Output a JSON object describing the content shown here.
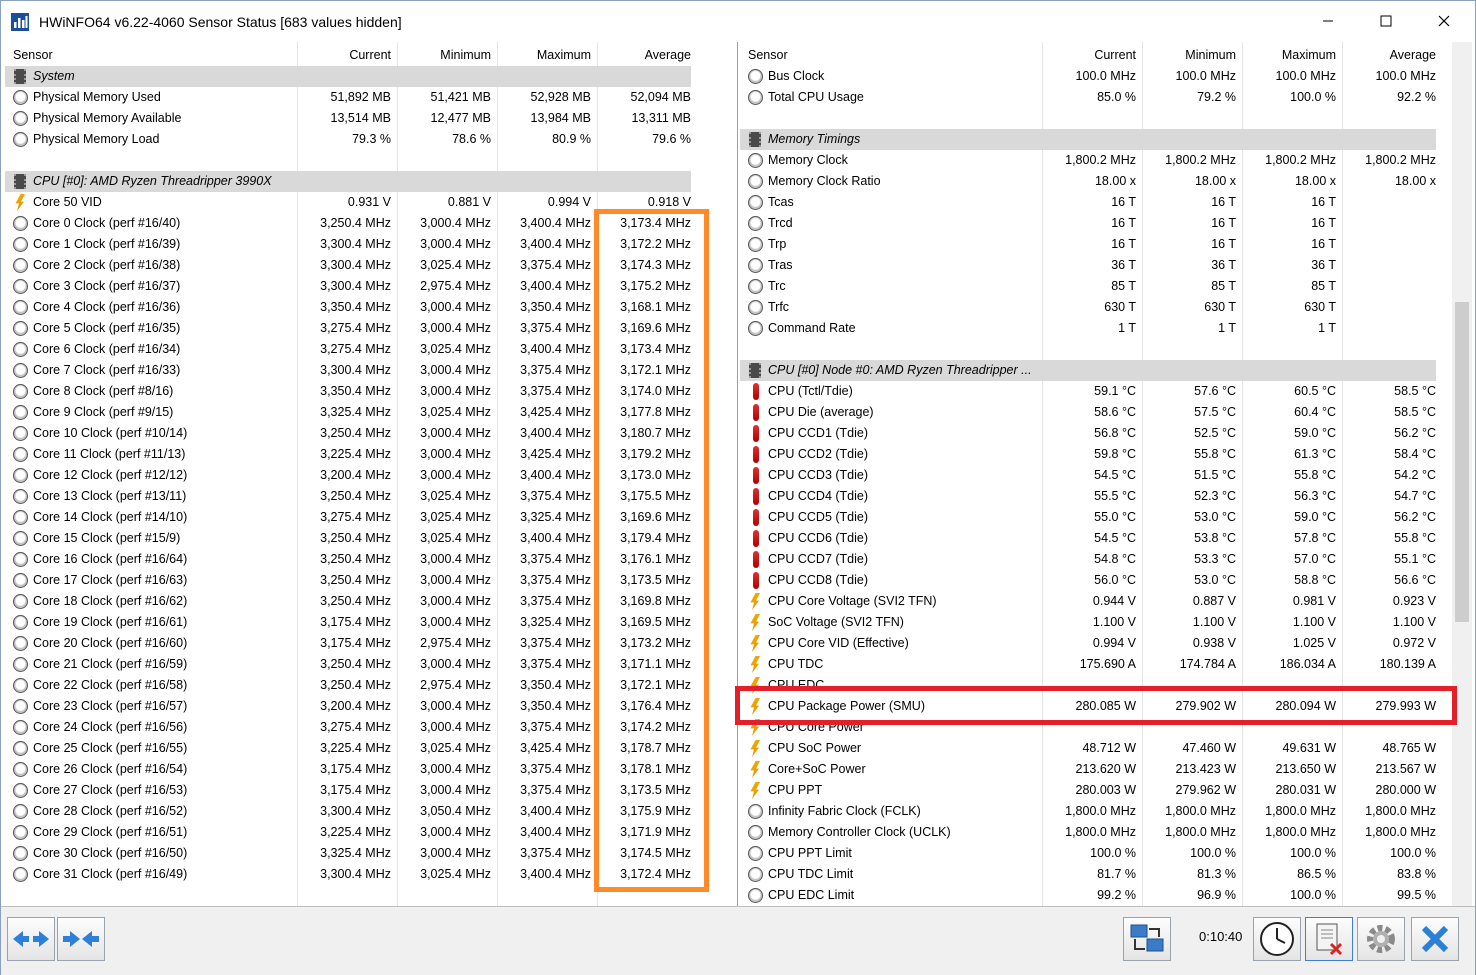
{
  "window": {
    "title": "HWiNFO64 v6.22-4060 Sensor Status [683 values hidden]",
    "min_icon": "minimize-icon",
    "max_icon": "maximize-icon",
    "close_icon": "close-icon"
  },
  "columns": [
    "Sensor",
    "Current",
    "Minimum",
    "Maximum",
    "Average"
  ],
  "left_rows": [
    {
      "type": "group",
      "name": "System",
      "icon": "chip"
    },
    {
      "name": "Physical Memory Used",
      "cur": "51,892 MB",
      "min": "51,421 MB",
      "max": "52,928 MB",
      "avg": "52,094 MB",
      "icon": "clock"
    },
    {
      "name": "Physical Memory Available",
      "cur": "13,514 MB",
      "min": "12,477 MB",
      "max": "13,984 MB",
      "avg": "13,311 MB",
      "icon": "clock"
    },
    {
      "name": "Physical Memory Load",
      "cur": "79.3 %",
      "min": "78.6 %",
      "max": "80.9 %",
      "avg": "79.6 %",
      "icon": "clock"
    },
    {
      "type": "blank"
    },
    {
      "type": "group",
      "name": "CPU [#0]: AMD Ryzen Threadripper 3990X",
      "icon": "chip"
    },
    {
      "name": "Core 50 VID",
      "cur": "0.931 V",
      "min": "0.881 V",
      "max": "0.994 V",
      "avg": "0.918 V",
      "icon": "volt"
    },
    {
      "name": "Core 0 Clock (perf #16/40)",
      "cur": "3,250.4 MHz",
      "min": "3,000.4 MHz",
      "max": "3,400.4 MHz",
      "avg": "3,173.4 MHz",
      "icon": "clock"
    },
    {
      "name": "Core 1 Clock (perf #16/39)",
      "cur": "3,300.4 MHz",
      "min": "3,000.4 MHz",
      "max": "3,400.4 MHz",
      "avg": "3,172.2 MHz",
      "icon": "clock"
    },
    {
      "name": "Core 2 Clock (perf #16/38)",
      "cur": "3,300.4 MHz",
      "min": "3,025.4 MHz",
      "max": "3,375.4 MHz",
      "avg": "3,174.3 MHz",
      "icon": "clock"
    },
    {
      "name": "Core 3 Clock (perf #16/37)",
      "cur": "3,300.4 MHz",
      "min": "2,975.4 MHz",
      "max": "3,400.4 MHz",
      "avg": "3,175.2 MHz",
      "icon": "clock"
    },
    {
      "name": "Core 4 Clock (perf #16/36)",
      "cur": "3,350.4 MHz",
      "min": "3,000.4 MHz",
      "max": "3,350.4 MHz",
      "avg": "3,168.1 MHz",
      "icon": "clock"
    },
    {
      "name": "Core 5 Clock (perf #16/35)",
      "cur": "3,275.4 MHz",
      "min": "3,000.4 MHz",
      "max": "3,375.4 MHz",
      "avg": "3,169.6 MHz",
      "icon": "clock"
    },
    {
      "name": "Core 6 Clock (perf #16/34)",
      "cur": "3,275.4 MHz",
      "min": "3,025.4 MHz",
      "max": "3,400.4 MHz",
      "avg": "3,173.4 MHz",
      "icon": "clock"
    },
    {
      "name": "Core 7 Clock (perf #16/33)",
      "cur": "3,300.4 MHz",
      "min": "3,000.4 MHz",
      "max": "3,375.4 MHz",
      "avg": "3,172.1 MHz",
      "icon": "clock"
    },
    {
      "name": "Core 8 Clock (perf #8/16)",
      "cur": "3,350.4 MHz",
      "min": "3,000.4 MHz",
      "max": "3,375.4 MHz",
      "avg": "3,174.0 MHz",
      "icon": "clock"
    },
    {
      "name": "Core 9 Clock (perf #9/15)",
      "cur": "3,325.4 MHz",
      "min": "3,025.4 MHz",
      "max": "3,425.4 MHz",
      "avg": "3,177.8 MHz",
      "icon": "clock"
    },
    {
      "name": "Core 10 Clock (perf #10/14)",
      "cur": "3,250.4 MHz",
      "min": "3,000.4 MHz",
      "max": "3,400.4 MHz",
      "avg": "3,180.7 MHz",
      "icon": "clock"
    },
    {
      "name": "Core 11 Clock (perf #11/13)",
      "cur": "3,225.4 MHz",
      "min": "3,000.4 MHz",
      "max": "3,425.4 MHz",
      "avg": "3,179.2 MHz",
      "icon": "clock"
    },
    {
      "name": "Core 12 Clock (perf #12/12)",
      "cur": "3,200.4 MHz",
      "min": "3,000.4 MHz",
      "max": "3,400.4 MHz",
      "avg": "3,173.0 MHz",
      "icon": "clock"
    },
    {
      "name": "Core 13 Clock (perf #13/11)",
      "cur": "3,250.4 MHz",
      "min": "3,025.4 MHz",
      "max": "3,375.4 MHz",
      "avg": "3,175.5 MHz",
      "icon": "clock"
    },
    {
      "name": "Core 14 Clock (perf #14/10)",
      "cur": "3,275.4 MHz",
      "min": "3,025.4 MHz",
      "max": "3,325.4 MHz",
      "avg": "3,169.6 MHz",
      "icon": "clock"
    },
    {
      "name": "Core 15 Clock (perf #15/9)",
      "cur": "3,250.4 MHz",
      "min": "3,025.4 MHz",
      "max": "3,400.4 MHz",
      "avg": "3,179.4 MHz",
      "icon": "clock"
    },
    {
      "name": "Core 16 Clock (perf #16/64)",
      "cur": "3,250.4 MHz",
      "min": "3,000.4 MHz",
      "max": "3,375.4 MHz",
      "avg": "3,176.1 MHz",
      "icon": "clock"
    },
    {
      "name": "Core 17 Clock (perf #16/63)",
      "cur": "3,250.4 MHz",
      "min": "3,000.4 MHz",
      "max": "3,375.4 MHz",
      "avg": "3,173.5 MHz",
      "icon": "clock"
    },
    {
      "name": "Core 18 Clock (perf #16/62)",
      "cur": "3,250.4 MHz",
      "min": "3,000.4 MHz",
      "max": "3,375.4 MHz",
      "avg": "3,169.8 MHz",
      "icon": "clock"
    },
    {
      "name": "Core 19 Clock (perf #16/61)",
      "cur": "3,175.4 MHz",
      "min": "3,000.4 MHz",
      "max": "3,325.4 MHz",
      "avg": "3,169.5 MHz",
      "icon": "clock"
    },
    {
      "name": "Core 20 Clock (perf #16/60)",
      "cur": "3,175.4 MHz",
      "min": "2,975.4 MHz",
      "max": "3,375.4 MHz",
      "avg": "3,173.2 MHz",
      "icon": "clock"
    },
    {
      "name": "Core 21 Clock (perf #16/59)",
      "cur": "3,250.4 MHz",
      "min": "3,000.4 MHz",
      "max": "3,375.4 MHz",
      "avg": "3,171.1 MHz",
      "icon": "clock"
    },
    {
      "name": "Core 22 Clock (perf #16/58)",
      "cur": "3,250.4 MHz",
      "min": "2,975.4 MHz",
      "max": "3,350.4 MHz",
      "avg": "3,172.1 MHz",
      "icon": "clock"
    },
    {
      "name": "Core 23 Clock (perf #16/57)",
      "cur": "3,200.4 MHz",
      "min": "3,000.4 MHz",
      "max": "3,350.4 MHz",
      "avg": "3,176.4 MHz",
      "icon": "clock"
    },
    {
      "name": "Core 24 Clock (perf #16/56)",
      "cur": "3,275.4 MHz",
      "min": "3,000.4 MHz",
      "max": "3,375.4 MHz",
      "avg": "3,174.2 MHz",
      "icon": "clock"
    },
    {
      "name": "Core 25 Clock (perf #16/55)",
      "cur": "3,225.4 MHz",
      "min": "3,025.4 MHz",
      "max": "3,425.4 MHz",
      "avg": "3,178.7 MHz",
      "icon": "clock"
    },
    {
      "name": "Core 26 Clock (perf #16/54)",
      "cur": "3,175.4 MHz",
      "min": "3,000.4 MHz",
      "max": "3,375.4 MHz",
      "avg": "3,178.1 MHz",
      "icon": "clock"
    },
    {
      "name": "Core 27 Clock (perf #16/53)",
      "cur": "3,175.4 MHz",
      "min": "3,000.4 MHz",
      "max": "3,375.4 MHz",
      "avg": "3,173.5 MHz",
      "icon": "clock"
    },
    {
      "name": "Core 28 Clock (perf #16/52)",
      "cur": "3,300.4 MHz",
      "min": "3,050.4 MHz",
      "max": "3,400.4 MHz",
      "avg": "3,175.9 MHz",
      "icon": "clock"
    },
    {
      "name": "Core 29 Clock (perf #16/51)",
      "cur": "3,225.4 MHz",
      "min": "3,000.4 MHz",
      "max": "3,400.4 MHz",
      "avg": "3,171.9 MHz",
      "icon": "clock"
    },
    {
      "name": "Core 30 Clock (perf #16/50)",
      "cur": "3,325.4 MHz",
      "min": "3,000.4 MHz",
      "max": "3,375.4 MHz",
      "avg": "3,174.5 MHz",
      "icon": "clock"
    },
    {
      "name": "Core 31 Clock (perf #16/49)",
      "cur": "3,300.4 MHz",
      "min": "3,025.4 MHz",
      "max": "3,400.4 MHz",
      "avg": "3,172.4 MHz",
      "icon": "clock"
    }
  ],
  "right_rows": [
    {
      "name": "Bus Clock",
      "cur": "100.0 MHz",
      "min": "100.0 MHz",
      "max": "100.0 MHz",
      "avg": "100.0 MHz",
      "icon": "clock"
    },
    {
      "name": "Total CPU Usage",
      "cur": "85.0 %",
      "min": "79.2 %",
      "max": "100.0 %",
      "avg": "92.2 %",
      "icon": "clock"
    },
    {
      "type": "blank"
    },
    {
      "type": "group",
      "name": "Memory Timings",
      "icon": "chip"
    },
    {
      "name": "Memory Clock",
      "cur": "1,800.2 MHz",
      "min": "1,800.2 MHz",
      "max": "1,800.2 MHz",
      "avg": "1,800.2 MHz",
      "icon": "clock"
    },
    {
      "name": "Memory Clock Ratio",
      "cur": "18.00 x",
      "min": "18.00 x",
      "max": "18.00 x",
      "avg": "18.00 x",
      "icon": "clock"
    },
    {
      "name": "Tcas",
      "cur": "16 T",
      "min": "16 T",
      "max": "16 T",
      "avg": "",
      "icon": "clock"
    },
    {
      "name": "Trcd",
      "cur": "16 T",
      "min": "16 T",
      "max": "16 T",
      "avg": "",
      "icon": "clock"
    },
    {
      "name": "Trp",
      "cur": "16 T",
      "min": "16 T",
      "max": "16 T",
      "avg": "",
      "icon": "clock"
    },
    {
      "name": "Tras",
      "cur": "36 T",
      "min": "36 T",
      "max": "36 T",
      "avg": "",
      "icon": "clock"
    },
    {
      "name": "Trc",
      "cur": "85 T",
      "min": "85 T",
      "max": "85 T",
      "avg": "",
      "icon": "clock"
    },
    {
      "name": "Trfc",
      "cur": "630 T",
      "min": "630 T",
      "max": "630 T",
      "avg": "",
      "icon": "clock"
    },
    {
      "name": "Command Rate",
      "cur": "1 T",
      "min": "1 T",
      "max": "1 T",
      "avg": "",
      "icon": "clock"
    },
    {
      "type": "blank"
    },
    {
      "type": "group",
      "name": "CPU [#0] Node #0: AMD Ryzen Threadripper ...",
      "icon": "chip"
    },
    {
      "name": "CPU (Tctl/Tdie)",
      "cur": "59.1 °C",
      "min": "57.6 °C",
      "max": "60.5 °C",
      "avg": "58.5 °C",
      "icon": "temp"
    },
    {
      "name": "CPU Die (average)",
      "cur": "58.6 °C",
      "min": "57.5 °C",
      "max": "60.4 °C",
      "avg": "58.5 °C",
      "icon": "temp"
    },
    {
      "name": "CPU CCD1 (Tdie)",
      "cur": "56.8 °C",
      "min": "52.5 °C",
      "max": "59.0 °C",
      "avg": "56.2 °C",
      "icon": "temp"
    },
    {
      "name": "CPU CCD2 (Tdie)",
      "cur": "59.8 °C",
      "min": "55.8 °C",
      "max": "61.3 °C",
      "avg": "58.4 °C",
      "icon": "temp"
    },
    {
      "name": "CPU CCD3 (Tdie)",
      "cur": "54.5 °C",
      "min": "51.5 °C",
      "max": "55.8 °C",
      "avg": "54.2 °C",
      "icon": "temp"
    },
    {
      "name": "CPU CCD4 (Tdie)",
      "cur": "55.5 °C",
      "min": "52.3 °C",
      "max": "56.3 °C",
      "avg": "54.7 °C",
      "icon": "temp"
    },
    {
      "name": "CPU CCD5 (Tdie)",
      "cur": "55.0 °C",
      "min": "53.0 °C",
      "max": "59.0 °C",
      "avg": "56.2 °C",
      "icon": "temp"
    },
    {
      "name": "CPU CCD6 (Tdie)",
      "cur": "54.5 °C",
      "min": "53.8 °C",
      "max": "57.8 °C",
      "avg": "55.8 °C",
      "icon": "temp"
    },
    {
      "name": "CPU CCD7 (Tdie)",
      "cur": "54.8 °C",
      "min": "53.3 °C",
      "max": "57.0 °C",
      "avg": "55.1 °C",
      "icon": "temp"
    },
    {
      "name": "CPU CCD8 (Tdie)",
      "cur": "56.0 °C",
      "min": "53.0 °C",
      "max": "58.8 °C",
      "avg": "56.6 °C",
      "icon": "temp"
    },
    {
      "name": "CPU Core Voltage (SVI2 TFN)",
      "cur": "0.944 V",
      "min": "0.887 V",
      "max": "0.981 V",
      "avg": "0.923 V",
      "icon": "volt"
    },
    {
      "name": "SoC Voltage (SVI2 TFN)",
      "cur": "1.100 V",
      "min": "1.100 V",
      "max": "1.100 V",
      "avg": "1.100 V",
      "icon": "volt"
    },
    {
      "name": "CPU Core VID (Effective)",
      "cur": "0.994 V",
      "min": "0.938 V",
      "max": "1.025 V",
      "avg": "0.972 V",
      "icon": "volt"
    },
    {
      "name": "CPU TDC",
      "cur": "175.690 A",
      "min": "174.784 A",
      "max": "186.034 A",
      "avg": "180.139 A",
      "icon": "volt"
    },
    {
      "name": "CPU EDC",
      "cur": "",
      "min": "",
      "max": "",
      "avg": "",
      "icon": "volt"
    },
    {
      "name": "CPU Package Power (SMU)",
      "cur": "280.085 W",
      "min": "279.902 W",
      "max": "280.094 W",
      "avg": "279.993 W",
      "icon": "volt"
    },
    {
      "name": "CPU Core Power",
      "cur": "",
      "min": "",
      "max": "",
      "avg": "",
      "icon": "volt"
    },
    {
      "name": "CPU SoC Power",
      "cur": "48.712 W",
      "min": "47.460 W",
      "max": "49.631 W",
      "avg": "48.765 W",
      "icon": "volt"
    },
    {
      "name": "Core+SoC Power",
      "cur": "213.620 W",
      "min": "213.423 W",
      "max": "213.650 W",
      "avg": "213.567 W",
      "icon": "volt"
    },
    {
      "name": "CPU PPT",
      "cur": "280.003 W",
      "min": "279.962 W",
      "max": "280.031 W",
      "avg": "280.000 W",
      "icon": "volt"
    },
    {
      "name": "Infinity Fabric Clock (FCLK)",
      "cur": "1,800.0 MHz",
      "min": "1,800.0 MHz",
      "max": "1,800.0 MHz",
      "avg": "1,800.0 MHz",
      "icon": "clock"
    },
    {
      "name": "Memory Controller Clock (UCLK)",
      "cur": "1,800.0 MHz",
      "min": "1,800.0 MHz",
      "max": "1,800.0 MHz",
      "avg": "1,800.0 MHz",
      "icon": "clock"
    },
    {
      "name": "CPU PPT Limit",
      "cur": "100.0 %",
      "min": "100.0 %",
      "max": "100.0 %",
      "avg": "100.0 %",
      "icon": "clock"
    },
    {
      "name": "CPU TDC Limit",
      "cur": "81.7 %",
      "min": "81.3 %",
      "max": "86.5 %",
      "avg": "83.8 %",
      "icon": "clock"
    },
    {
      "name": "CPU EDC Limit",
      "cur": "99.2 %",
      "min": "96.9 %",
      "max": "100.0 %",
      "avg": "99.5 %",
      "icon": "clock"
    }
  ],
  "toolbar": {
    "elapsed": "0:10:40",
    "buttons": [
      "expand-arrows-icon",
      "collapse-arrows-icon",
      "network-icon",
      "clock-icon",
      "reset-report-icon",
      "settings-gear-icon",
      "close-x-icon"
    ]
  },
  "colors": {
    "highlight_orange": "#ff8a2a",
    "highlight_red": "#e3202a",
    "group_row": "#d9d9d9"
  }
}
